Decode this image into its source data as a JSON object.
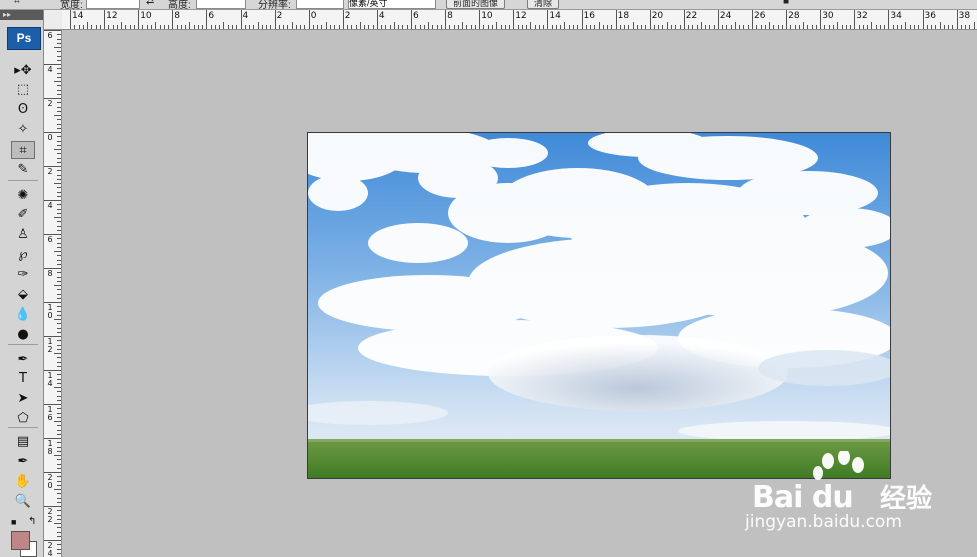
{
  "options_bar": {
    "width_label": "宽度:",
    "height_label": "高度:",
    "resolution_label": "分辨率:",
    "resolution_unit": "像素/英寸",
    "front_image_button": "前面的图像",
    "clear_button": "清除"
  },
  "ruler": {
    "horizontal_labels": [
      "14",
      "12",
      "10",
      "8",
      "6",
      "4",
      "2",
      "0",
      "2",
      "4",
      "6",
      "8",
      "10",
      "12",
      "14",
      "16",
      "18",
      "20",
      "22",
      "24",
      "26",
      "28",
      "30",
      "32",
      "34",
      "36",
      "38"
    ],
    "vertical_labels": [
      "6",
      "4",
      "2",
      "0",
      "2",
      "4",
      "6",
      "8",
      "1\n0",
      "1\n2",
      "1\n4",
      "1\n6",
      "1\n8",
      "2\n0",
      "2\n2",
      "2\n4"
    ]
  },
  "toolbox": {
    "logo": "Ps",
    "tools": [
      {
        "name": "move-tool-icon",
        "glyph": "▸✥"
      },
      {
        "name": "marquee-tool-icon",
        "glyph": "⬚"
      },
      {
        "name": "lasso-tool-icon",
        "glyph": "ʘ"
      },
      {
        "name": "magic-wand-tool-icon",
        "glyph": "✧"
      },
      {
        "name": "crop-tool-icon",
        "glyph": "⌗"
      },
      {
        "name": "slice-tool-icon",
        "glyph": "✎"
      },
      {
        "name": "healing-brush-tool-icon",
        "glyph": "✺"
      },
      {
        "name": "brush-tool-icon",
        "glyph": "✐"
      },
      {
        "name": "clone-stamp-tool-icon",
        "glyph": "♙"
      },
      {
        "name": "history-brush-tool-icon",
        "glyph": "℘"
      },
      {
        "name": "eraser-tool-icon",
        "glyph": "✑"
      },
      {
        "name": "paint-bucket-tool-icon",
        "glyph": "⬙"
      },
      {
        "name": "blur-tool-icon",
        "glyph": "💧"
      },
      {
        "name": "dodge-tool-icon",
        "glyph": "●"
      },
      {
        "name": "pen-tool-icon",
        "glyph": "✒"
      },
      {
        "name": "type-tool-icon",
        "glyph": "T"
      },
      {
        "name": "path-selection-tool-icon",
        "glyph": "➤"
      },
      {
        "name": "shape-tool-icon",
        "glyph": "⬠"
      },
      {
        "name": "notes-tool-icon",
        "glyph": "▤"
      },
      {
        "name": "eyedropper-tool-icon",
        "glyph": "✒"
      },
      {
        "name": "hand-tool-icon",
        "glyph": "✋"
      },
      {
        "name": "zoom-tool-icon",
        "glyph": "🔍"
      }
    ],
    "foreground_color": "#c08686",
    "background_color": "#ffffff"
  },
  "watermark": {
    "brand": "Bai  du",
    "brand_cn": "经验",
    "url": "jingyan.baidu.com"
  }
}
